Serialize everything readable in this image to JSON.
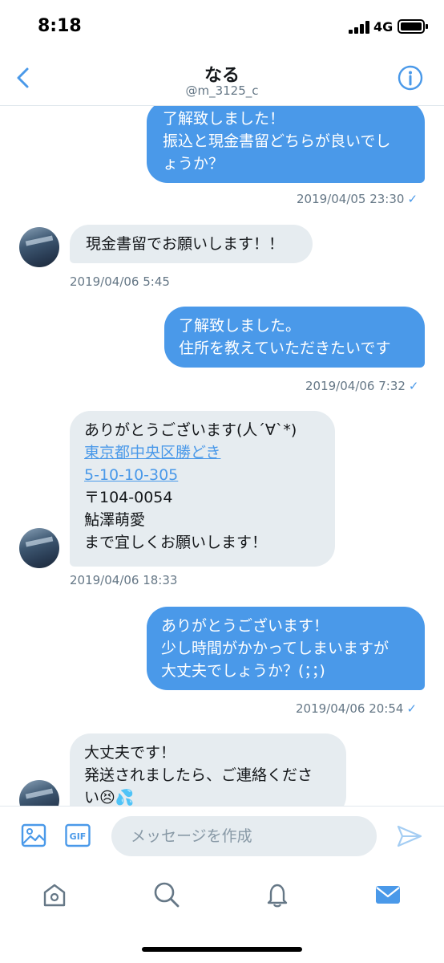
{
  "status": {
    "time": "8:18",
    "network": "4G"
  },
  "header": {
    "name": "なる",
    "handle": "@m_3125_c"
  },
  "messages": [
    {
      "side": "out",
      "text": "了解致しました！\n振込と現金書留どちらが良いでし\nょうか？",
      "time": "2019/04/05 23:30"
    },
    {
      "side": "in",
      "text": "現金書留でお願いします！！",
      "time": "2019/04/06 5:45"
    },
    {
      "side": "out",
      "text": "了解致しました。\n住所を教えていただきたいです",
      "time": "2019/04/06 7:32"
    },
    {
      "side": "in",
      "line1": "ありがとうございます(人´∀`*)",
      "link1": "東京都中央区勝どき",
      "link2": "5-10-10-305",
      "line4": "〒104-0054",
      "line5": "鮎澤萌愛",
      "line6": "まで宜しくお願いします！",
      "time": "2019/04/06 18:33"
    },
    {
      "side": "out",
      "text": "ありがとうございます！\n少し時間がかかってしまいますが\n大丈夫でしょうか？(；；)",
      "time": "2019/04/06 20:54"
    },
    {
      "side": "in",
      "text": "大丈夫です！\n発送されましたら、ご連絡くださ\nい😣💦"
    }
  ],
  "compose": {
    "placeholder": "メッセージを作成",
    "gif_label": "GIF"
  },
  "icons": {
    "back": "chevron-left-icon",
    "info": "info-icon",
    "image": "image-icon",
    "gif": "gif-icon",
    "send": "send-icon",
    "home": "home-icon",
    "search": "search-icon",
    "notifications": "bell-icon",
    "messages": "mail-icon"
  },
  "colors": {
    "accent": "#4a99e9",
    "incoming_bubble": "#e6ecf0",
    "muted_text": "#657786"
  }
}
